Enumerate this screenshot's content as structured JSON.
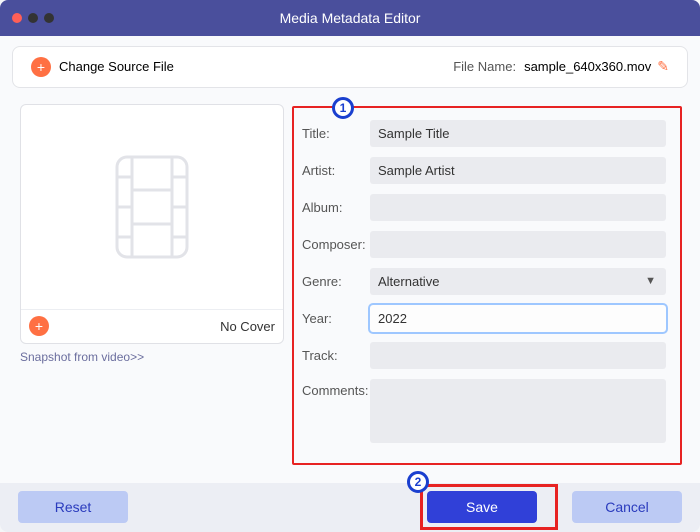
{
  "window": {
    "title": "Media Metadata Editor"
  },
  "toolbar": {
    "change_source_label": "Change Source File",
    "filename_label": "File Name:",
    "filename": "sample_640x360.mov"
  },
  "cover": {
    "no_cover_label": "No Cover",
    "snapshot_label": "Snapshot from video>>"
  },
  "form": {
    "title_label": "Title:",
    "title_value": "Sample Title",
    "artist_label": "Artist:",
    "artist_value": "Sample Artist",
    "album_label": "Album:",
    "album_value": "",
    "composer_label": "Composer:",
    "composer_value": "",
    "genre_label": "Genre:",
    "genre_value": "Alternative",
    "year_label": "Year:",
    "year_value": "2022",
    "track_label": "Track:",
    "track_value": "",
    "comments_label": "Comments:",
    "comments_value": ""
  },
  "buttons": {
    "reset": "Reset",
    "save": "Save",
    "cancel": "Cancel"
  },
  "callouts": {
    "one": "1",
    "two": "2"
  }
}
